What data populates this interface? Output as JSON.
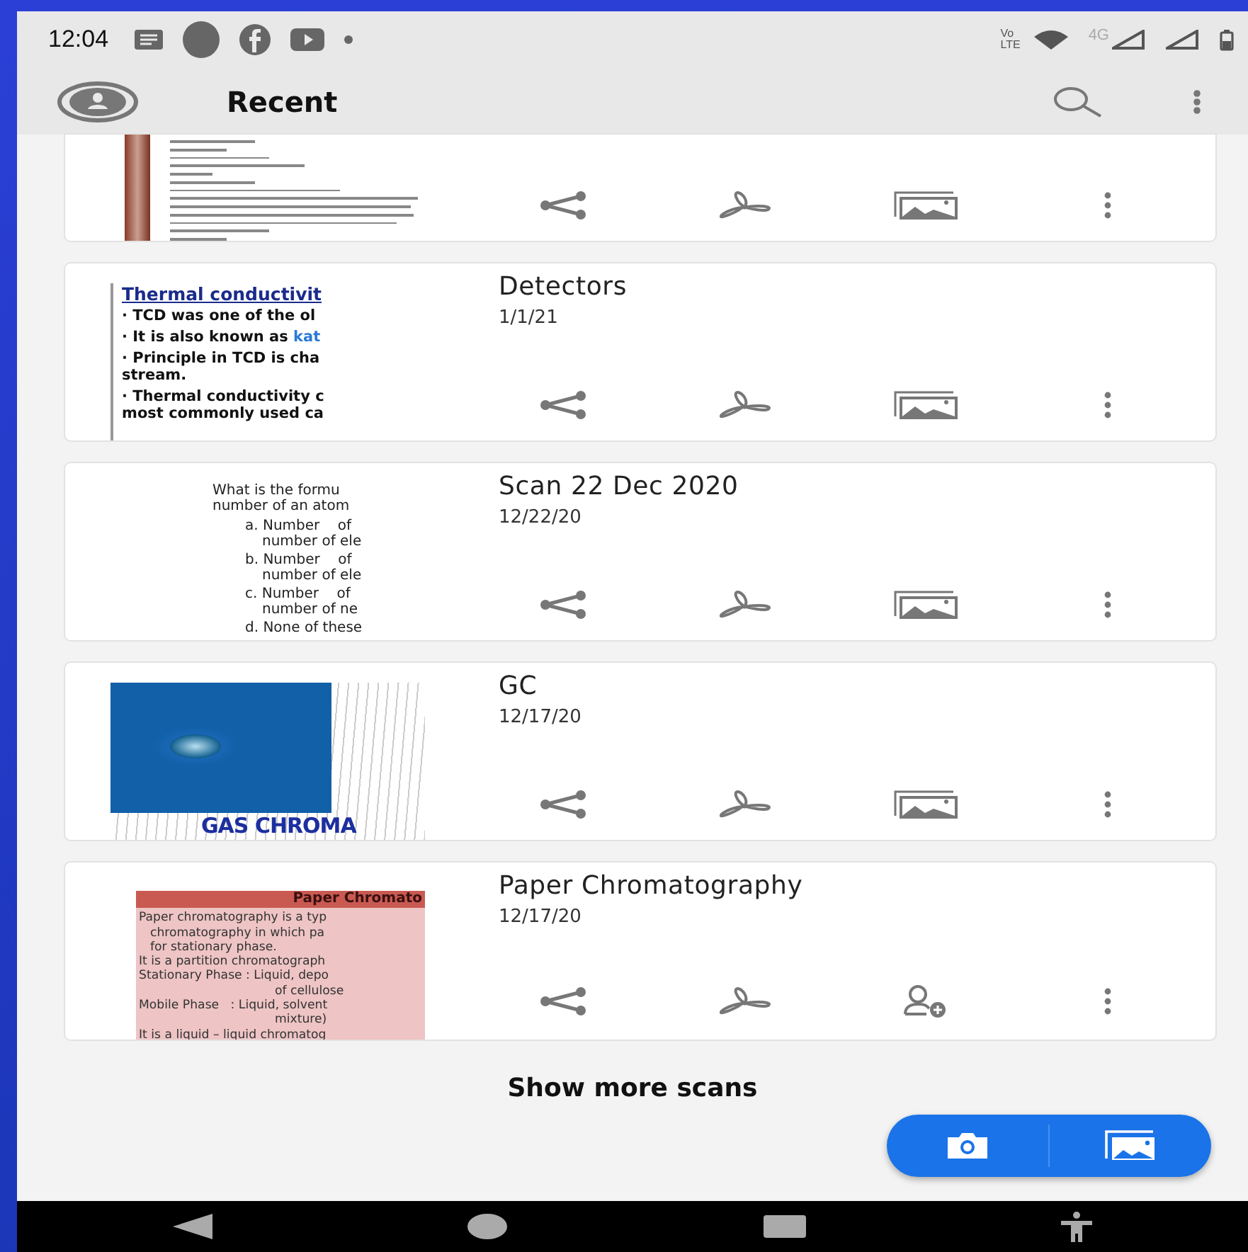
{
  "status_bar": {
    "time": "12:04",
    "volte_top": "Vo",
    "volte_bottom": "LTE",
    "network_type": "4G"
  },
  "toolbar": {
    "title": "Recent"
  },
  "scans": [
    {
      "thumbnail": {
        "kind": "letter"
      },
      "actions": [
        {
          "kind": "share"
        },
        {
          "kind": "pdf"
        },
        {
          "kind": "image"
        },
        {
          "kind": "more"
        }
      ]
    },
    {
      "title": "Detectors",
      "date": "1/1/21",
      "thumbnail": {
        "kind": "slide",
        "heading": "Thermal conductivit",
        "bullets": [
          {
            "lines": [
              "· TCD was one of the ol"
            ]
          },
          {
            "lines": [
              "· It is also known as "
            ],
            "accent": "kat"
          },
          {
            "lines": [
              "· Principle in TCD is cha",
              "stream."
            ]
          },
          {
            "lines": [
              "· Thermal conductivity c",
              "most commonly used ca"
            ]
          }
        ]
      },
      "actions": [
        {
          "kind": "share"
        },
        {
          "kind": "pdf"
        },
        {
          "kind": "image"
        },
        {
          "kind": "more"
        }
      ]
    },
    {
      "title": "Scan 22 Dec 2020",
      "date": "12/22/20",
      "thumbnail": {
        "kind": "quiz",
        "question": [
          "What is the formu",
          "number of an atom"
        ],
        "options": [
          [
            "a. Number    of",
            "number of ele"
          ],
          [
            "b. Number    of",
            "number of ele"
          ],
          [
            "c. Number    of",
            "number of ne"
          ],
          [
            "d. None of these"
          ]
        ]
      },
      "actions": [
        {
          "kind": "share"
        },
        {
          "kind": "pdf"
        },
        {
          "kind": "image"
        },
        {
          "kind": "more"
        }
      ]
    },
    {
      "title": "GC",
      "date": "12/17/20",
      "thumbnail": {
        "kind": "photo",
        "caption": "GAS CHROMA"
      },
      "actions": [
        {
          "kind": "share"
        },
        {
          "kind": "pdf"
        },
        {
          "kind": "image"
        },
        {
          "kind": "more"
        }
      ]
    },
    {
      "title": "Paper Chromatography",
      "date": "12/17/20",
      "thumbnail": {
        "kind": "notes",
        "heading": "Paper Chromato",
        "lines": [
          {
            "text": "Paper chromatography is a typ",
            "kind": "left"
          },
          {
            "text": "chromatography in which pa",
            "kind": "hang"
          },
          {
            "text": "for stationary phase.",
            "kind": "hang"
          },
          {
            "text": "It is a partition chromatograph",
            "kind": "left"
          },
          {
            "text": "Stationary Phase : Liquid, depo",
            "kind": "left"
          },
          {
            "text": "of cellulose",
            "kind": "right"
          },
          {
            "text": "Mobile Phase   : Liquid, solvent",
            "kind": "left"
          },
          {
            "text": "mixture)",
            "kind": "right"
          },
          {
            "text": "It is a liquid – liquid chromatog",
            "kind": "left"
          }
        ]
      },
      "actions": [
        {
          "kind": "share"
        },
        {
          "kind": "pdf"
        },
        {
          "kind": "person-add"
        },
        {
          "kind": "more"
        }
      ]
    }
  ],
  "show_more": "Show more scans",
  "fab": [
    {
      "kind": "camera"
    },
    {
      "kind": "gallery"
    }
  ]
}
